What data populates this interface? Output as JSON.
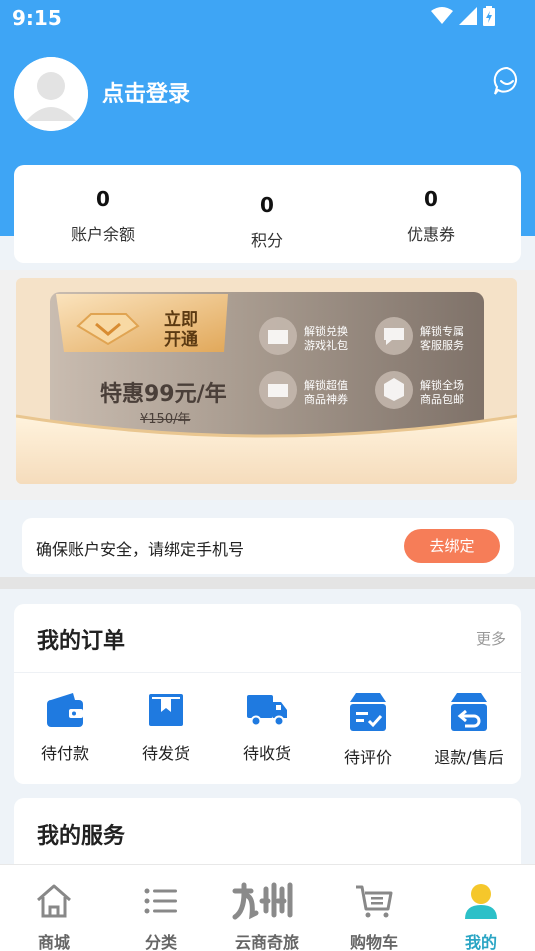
{
  "status_bar": {
    "time": "9:15"
  },
  "profile": {
    "login_text": "点击登录"
  },
  "stats": [
    {
      "value": "0",
      "label": "账户余额"
    },
    {
      "value": "0",
      "label": "积分"
    },
    {
      "value": "0",
      "label": "优惠券"
    }
  ],
  "vip": {
    "open_line1": "立即",
    "open_line2": "开通",
    "price": "特惠99元/年",
    "original_price": "¥150/年",
    "benefits": [
      {
        "line1": "解锁兑换",
        "line2": "游戏礼包"
      },
      {
        "line1": "解锁专属",
        "line2": "客服服务"
      },
      {
        "line1": "解锁超值",
        "line2": "商品神券"
      },
      {
        "line1": "解锁全场",
        "line2": "商品包邮"
      }
    ]
  },
  "bind_phone": {
    "message": "确保账户安全，请绑定手机号",
    "button": "去绑定"
  },
  "orders": {
    "title": "我的订单",
    "more": "更多",
    "items": [
      {
        "label": "待付款",
        "icon": "wallet-icon"
      },
      {
        "label": "待发货",
        "icon": "box-icon"
      },
      {
        "label": "待收货",
        "icon": "truck-icon"
      },
      {
        "label": "待评价",
        "icon": "review-icon"
      },
      {
        "label": "退款/售后",
        "icon": "refund-icon"
      }
    ]
  },
  "services": {
    "title": "我的服务"
  },
  "tabbar": [
    {
      "label": "商城",
      "icon": "home-icon"
    },
    {
      "label": "分类",
      "icon": "list-icon"
    },
    {
      "label": "云商奇旅",
      "icon": "jiuzhou-logo"
    },
    {
      "label": "购物车",
      "icon": "cart-icon"
    },
    {
      "label": "我的",
      "icon": "person-icon"
    }
  ],
  "colors": {
    "primary": "#3ea5f5",
    "accent": "#f67d58",
    "icon_blue": "#1f7ae0",
    "active_tab": "#2aa5c4"
  }
}
